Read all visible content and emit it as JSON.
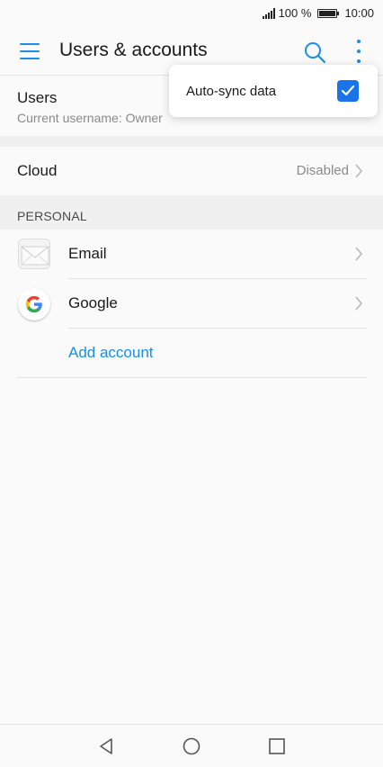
{
  "status_bar": {
    "battery_percent": "100 %",
    "time": "10:00"
  },
  "app_bar": {
    "title": "Users & accounts",
    "accent_color": "#1a8fe3"
  },
  "users_section": {
    "title": "Users",
    "subtitle": "Current username: Owner"
  },
  "cloud_row": {
    "title": "Cloud",
    "value": "Disabled"
  },
  "personal_section": {
    "header": "PERSONAL",
    "accounts": [
      {
        "label": "Email",
        "icon": "email-icon"
      },
      {
        "label": "Google",
        "icon": "google-icon"
      }
    ],
    "add_account_label": "Add account"
  },
  "menu_popup": {
    "auto_sync_label": "Auto-sync data",
    "auto_sync_checked": true
  },
  "nav_bar": {
    "buttons": [
      "back-icon",
      "home-icon",
      "recents-icon"
    ]
  }
}
